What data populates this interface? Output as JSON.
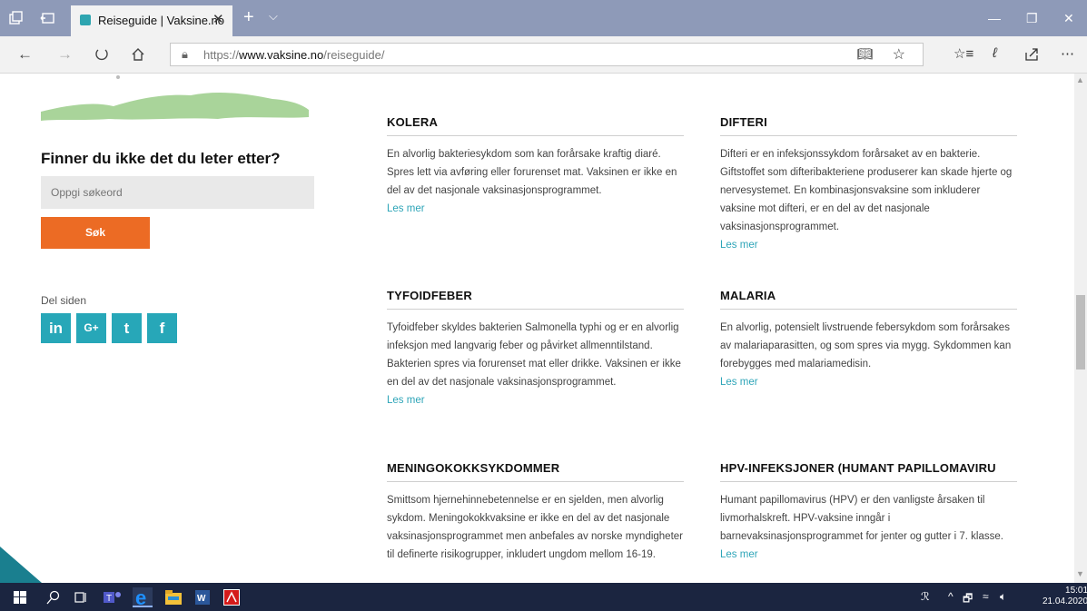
{
  "browser": {
    "tab_title": "Reiseguide | Vaksine.no",
    "tab_close": "✕",
    "new_tab": "+",
    "tab_menu": "⌵",
    "url_prefix": "https://",
    "url_domain": "www.vaksine.no",
    "url_path": "/reiseguide/",
    "window_controls": [
      "—",
      "❐",
      "✕"
    ]
  },
  "sidebar": {
    "search_heading": "Finner du ikke det du leter etter?",
    "search_placeholder": "Oppgi søkeord",
    "search_button": "Søk",
    "share_label": "Del siden",
    "social": [
      {
        "label": "in",
        "icon": "linkedin-icon"
      },
      {
        "label": "G+",
        "icon": "google-plus-icon"
      },
      {
        "label": "t",
        "icon": "twitter-icon"
      },
      {
        "label": "f",
        "icon": "facebook-icon"
      }
    ]
  },
  "diseases": [
    {
      "title": "KOLERA",
      "text": "En alvorlig bakteriesykdom som kan forårsake kraftig diaré. Spres lett via avføring eller forurenset mat. Vaksinen er ikke en del av det nasjonale vaksinasjonsprogrammet.",
      "more": "Les mer"
    },
    {
      "title": "DIFTERI",
      "text": "Difteri er en infeksjonssykdom forårsaket av en bakterie. Giftstoffet som difteribakteriene produserer kan skade hjerte og nervesystemet. En kombinasjonsvaksine som inkluderer vaksine mot difteri, er en del av det nasjonale vaksinasjonsprogrammet.",
      "more": "Les mer"
    },
    {
      "title": "TYFOIDFEBER",
      "text": "Tyfoidfeber skyldes bakterien Salmonella typhi og er en alvorlig infeksjon med langvarig feber og påvirket allmenntilstand. Bakterien spres via forurenset mat eller drikke. Vaksinen er ikke en del av det nasjonale vaksinasjonsprogrammet.",
      "more": "Les mer"
    },
    {
      "title": "MALARIA",
      "text": "En alvorlig, potensielt livstruende febersykdom som forårsakes av malariaparasitten, og som spres via mygg. Sykdommen kan forebygges med malariamedisin.",
      "more": "Les mer"
    },
    {
      "title": "MENINGOKOKKSYKDOMMER",
      "text": "Smittsom hjernehinnebetennelse er en sjelden, men alvorlig sykdom. Meningokokkvaksine er ikke en del av det nasjonale vaksinasjonsprogrammet men anbefales av norske myndigheter til definerte risikogrupper, inkludert ungdom mellom 16-19.",
      "more": ""
    },
    {
      "title": "HPV-INFEKSJONER (HUMANT PAPILLOMAVIRU",
      "text": "Humant papillomavirus (HPV) er den vanligste årsaken til livmorhalskreft. HPV-vaksine inngår i barnevaksinasjonsprogrammet for jenter og gutter i 7. klasse.",
      "more": "Les mer"
    }
  ],
  "taskbar": {
    "time": "15:01",
    "date": "21.04.2020"
  },
  "colors": {
    "accent": "#ec6b24",
    "teal": "#27a7b8",
    "chrome": "#8e9ab8",
    "taskbar": "#1b2540"
  }
}
